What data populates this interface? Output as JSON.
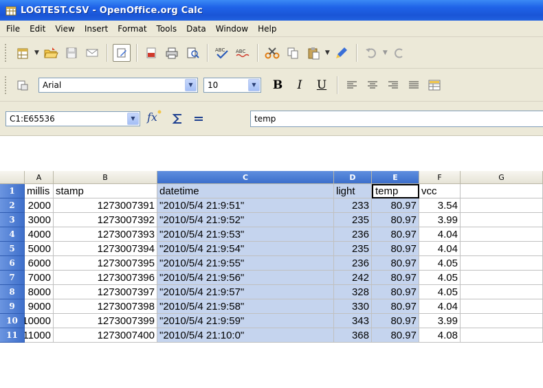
{
  "window": {
    "title": "LOGTEST.CSV - OpenOffice.org Calc"
  },
  "menu": [
    "File",
    "Edit",
    "View",
    "Insert",
    "Format",
    "Tools",
    "Data",
    "Window",
    "Help"
  ],
  "font_bar": {
    "font_name": "Arial",
    "font_size": "10"
  },
  "formula_bar": {
    "cell_reference": "C1:E65536",
    "content": "temp"
  },
  "columns": [
    "A",
    "B",
    "C",
    "D",
    "E",
    "F",
    "G"
  ],
  "rows": [
    {
      "n": "1",
      "cells": [
        "millis",
        "stamp",
        "datetime",
        "light",
        "temp",
        "vcc"
      ]
    },
    {
      "n": "2",
      "cells": [
        "2000",
        "1273007391",
        "\"2010/5/4 21:9:51\"",
        "233",
        "80.97",
        "3.54"
      ]
    },
    {
      "n": "3",
      "cells": [
        "3000",
        "1273007392",
        "\"2010/5/4 21:9:52\"",
        "235",
        "80.97",
        "3.99"
      ]
    },
    {
      "n": "4",
      "cells": [
        "4000",
        "1273007393",
        "\"2010/5/4 21:9:53\"",
        "236",
        "80.97",
        "4.04"
      ]
    },
    {
      "n": "5",
      "cells": [
        "5000",
        "1273007394",
        "\"2010/5/4 21:9:54\"",
        "235",
        "80.97",
        "4.04"
      ]
    },
    {
      "n": "6",
      "cells": [
        "6000",
        "1273007395",
        "\"2010/5/4 21:9:55\"",
        "236",
        "80.97",
        "4.05"
      ]
    },
    {
      "n": "7",
      "cells": [
        "7000",
        "1273007396",
        "\"2010/5/4 21:9:56\"",
        "242",
        "80.97",
        "4.05"
      ]
    },
    {
      "n": "8",
      "cells": [
        "8000",
        "1273007397",
        "\"2010/5/4 21:9:57\"",
        "328",
        "80.97",
        "4.05"
      ]
    },
    {
      "n": "9",
      "cells": [
        "9000",
        "1273007398",
        "\"2010/5/4 21:9:58\"",
        "330",
        "80.97",
        "4.04"
      ]
    },
    {
      "n": "10",
      "cells": [
        "10000",
        "1273007399",
        "\"2010/5/4 21:9:59\"",
        "343",
        "80.97",
        "3.99"
      ]
    },
    {
      "n": "11",
      "cells": [
        "11000",
        "1273007400",
        "\"2010/5/4 21:10:0\"",
        "368",
        "80.97",
        "4.08"
      ]
    }
  ],
  "colors": {
    "selection": "#c5d4ee",
    "row_header": "#3e6fcb",
    "title_bar": "#1f63e8"
  }
}
